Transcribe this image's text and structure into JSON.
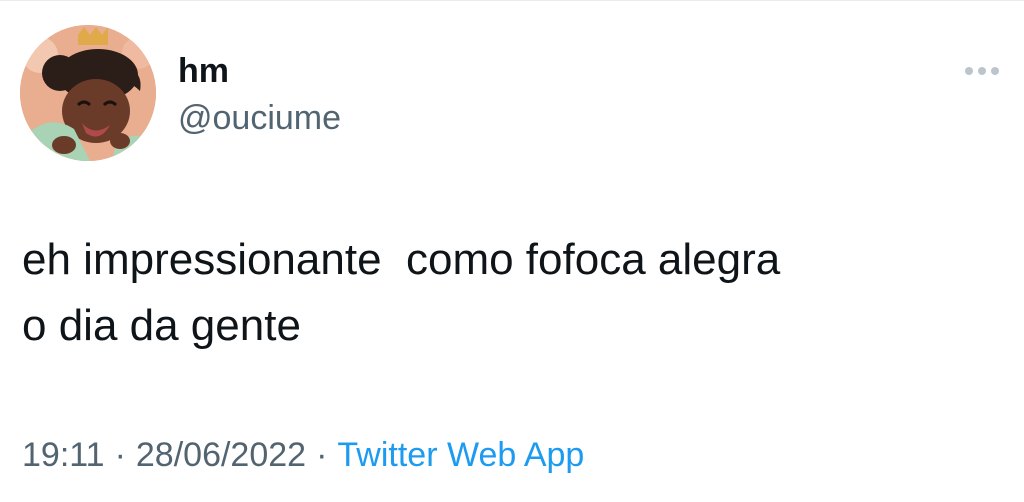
{
  "tweet": {
    "display_name": "hm",
    "handle": "@ouciume",
    "text_line1": "eh impressionante  como fofoca alegra",
    "text_line2": "o dia da gente",
    "time": "19:11",
    "separator": "·",
    "date": "28/06/2022",
    "source": "Twitter Web App",
    "more_icon": "more-horizontal-icon",
    "avatar_icon": "cartoon-girl-avatar"
  },
  "colors": {
    "text_primary": "#0f1419",
    "text_secondary": "#536471",
    "link": "#1d9bf0"
  }
}
